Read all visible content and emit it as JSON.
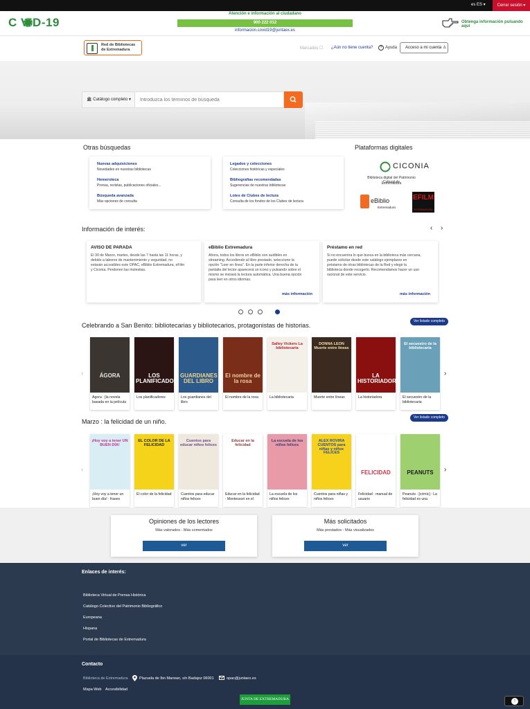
{
  "topbar": {
    "lang": "es ES ▾",
    "logout": "Cerrar sesión ▾"
  },
  "covid": {
    "logo": "C  VID-19",
    "attention": "Atención e información al ciudadano",
    "phone": "900 222 012",
    "email": "informacion.covid19@juntaex.es",
    "info_click": "Obtenga información pulsando aquí"
  },
  "header": {
    "logo_line1": "Red de Bibliotecas",
    "logo_line2": "de Extremadura",
    "marked": "Marcados ☐",
    "no_account": "¿Aún no tiene cuenta?",
    "help": "Ayuda",
    "account_btn": "Acceso a mi cuenta  ♙"
  },
  "search": {
    "catalog": "🏛 Catálogo completo ▾",
    "placeholder": "Introduzca los términos de búsqueda"
  },
  "other": {
    "title": "Otras búsquedas",
    "links": [
      {
        "t": "Nuevas adquisiciones",
        "d": "Novedades en nuestras bibliotecas"
      },
      {
        "t": "Hemeroteca",
        "d": "Prensa, revistas, publicaciones oficiales..."
      },
      {
        "t": "Búsqueda avanzada",
        "d": "Más opciones de consulta"
      },
      {
        "t": "Legados y colecciones",
        "d": "Colecciones históricas y especiales"
      },
      {
        "t": "Bibliografías recomendadas",
        "d": "Sugerencias de nuestras bibliotecas"
      },
      {
        "t": "Lotes de Clubes de lectura",
        "d": "Consulta de los fondos de los Clubes de lectura"
      }
    ]
  },
  "platforms": {
    "title": "Plataformas digitales",
    "ciconia": "CICONIA",
    "ciconia_desc1": "Biblioteca digital del Patrimonio Cultural de",
    "ciconia_desc2": "Extremadura",
    "ebiblio": "eBiblio",
    "ebiblio_sub": "Extremadura",
    "efilm": "EFILM",
    "efilm_sub": "EXTREMADURA"
  },
  "news": {
    "title": "Información de interés:",
    "prev": "‹",
    "next": "›",
    "items": [
      {
        "title": "AVISO DE PARADA",
        "body": [
          "El 30 de Marzo, martes, desde las 7 hasta las 11 horas, y",
          "debido a labores de mantenimiento y seguridad, no",
          "estarán accesibles este OPAC, eBiblio Extremadura, eFilm",
          "y Ciconia. Perdonen las molestias."
        ],
        "more": ""
      },
      {
        "title": "eBiblio Extremadura",
        "body": [
          "Ahora, todos los libros en eBiblio son audibles en",
          "streaming. Accediendo al libro prestado, seleccione la",
          "opción \"Leer en línea\". En la parte inferior derecha de la",
          "pantalla del lector aparecerá un icono y pulsando sobre el",
          "mismo se iniciará la lectura automática. Una buena opción",
          "para leer en otros idiomas."
        ],
        "more": "más información"
      },
      {
        "title": "Préstamo en red",
        "body": [
          "Si no encuentra lo que busca en la biblioteca más cercana,",
          "puede solicitar desde este catálogo ejemplares en",
          "préstamo de otras bibliotecas de la Red y elegir la",
          "biblioteca donde recogerlo. Recomendamos hacer un uso",
          "racional de este servicio."
        ],
        "more": "más información"
      }
    ]
  },
  "shelf1": {
    "title": "Celebrando a San Benito: bibliotecarias y bibliotecarios, protagonistas de historias.",
    "btn": "Ver listado completo",
    "prev": "‹",
    "next": "›",
    "books": [
      {
        "cover": "ÁGORA",
        "cap": "Agora : [la novela basada en la película",
        "bg": "#3a3530",
        "fg": "#e8e8e8"
      },
      {
        "cover": "LOS PLANIFICADORES",
        "cap": "Los planificadores",
        "bg": "#2a1414",
        "fg": "#ffffff"
      },
      {
        "cover": "GUARDIANES DEL LIBRO",
        "cap": "Los guardianes del libro",
        "bg": "#2c5a8a",
        "fg": "#f4d58a"
      },
      {
        "cover": "El nombre de la rosa",
        "cap": "El nombre de la rosa",
        "bg": "#7a2e1a",
        "fg": "#f0d0a0"
      },
      {
        "cover": "Salley Vickers La bibliotecaria",
        "cap": "La bibliotecaria",
        "bg": "#f3f0ea",
        "fg": "#b02030"
      },
      {
        "cover": "DONNA LEON Muerte entre líneas",
        "cap": "Muerte entre líneas",
        "bg": "#3a2a20",
        "fg": "#f3e2b0"
      },
      {
        "cover": "LA HISTORIADORA",
        "cap": "La historiadora",
        "bg": "#8a1010",
        "fg": "#ffffff"
      },
      {
        "cover": "El secuestro de la bibliotecaria",
        "cap": "El secuestro de la bibliotecaria",
        "bg": "#6aa0b8",
        "fg": "#ffffff"
      }
    ]
  },
  "shelf2": {
    "title": "Marzo : la felicidad de un niño.",
    "btn": "Ver listado completo",
    "prev": "‹",
    "next": "›",
    "books": [
      {
        "cover": "¡Hoy voy a tener UN BUEN DÍA!",
        "cap": "¡Hoy voy a tener un buen día! : frases",
        "bg": "#d8eef4",
        "fg": "#c0308a"
      },
      {
        "cover": "EL COLOR DE LA FELICIDAD",
        "cap": "El color de la felicidad",
        "bg": "#f4d31a",
        "fg": "#222222"
      },
      {
        "cover": "Cuentos para educar niños felices",
        "cap": "Cuentos para educar niños felices",
        "bg": "#efe8dc",
        "fg": "#6a4a8a"
      },
      {
        "cover": "Educar en la felicidad",
        "cap": "Educar en la felicidad : Montessori en el",
        "bg": "#ffffff",
        "fg": "#8a3a3a"
      },
      {
        "cover": "La escuela de los niños felices",
        "cap": "La escuela de los niños felices",
        "bg": "#e89aa8",
        "fg": "#3a3a6a"
      },
      {
        "cover": "ALEX ROVIRA CUENTOS para niñas y niños FELICES",
        "cap": "Cuentos para niñas y niños felices",
        "bg": "#f6d21c",
        "fg": "#2a4aa0"
      },
      {
        "cover": "FELICIDAD",
        "cap": "Felicidad : manual de usuario",
        "bg": "#ffffff",
        "fg": "#d8304a"
      },
      {
        "cover": "PEANUTS",
        "cap": "Peanuts : [cómic] : La felicidad es una",
        "bg": "#9ed070",
        "fg": "#1a1a1a"
      }
    ]
  },
  "opinions": {
    "title": "Opiniones de los lectores",
    "sub": "Más valorados - Más comentados",
    "btn": "ver"
  },
  "requested": {
    "title": "Más solicitados",
    "sub": "Más prestados - Más visualizados",
    "btn": "ver"
  },
  "footer": {
    "links_title": "Enlaces de interés:",
    "links": [
      "Biblioteca Virtual de Prensa Histórica",
      "Catálogo Colectivo del Patrimonio Bibliográfico",
      "Europeana",
      "Hispana",
      "Portal de Bibliotecas de Extremadura"
    ],
    "contact_title": "Contacto",
    "contact_name": "Biblioteca de Extremadura",
    "address": "Plazuela de Ibn Marwan, s/n Badajoz 06001",
    "email": "opac@juntaex.es",
    "sitemap": "Mapa Web",
    "accessibility": "Accesibilidad",
    "junta": "JUNTA DE EXTREMADURA",
    "top": "↑"
  }
}
